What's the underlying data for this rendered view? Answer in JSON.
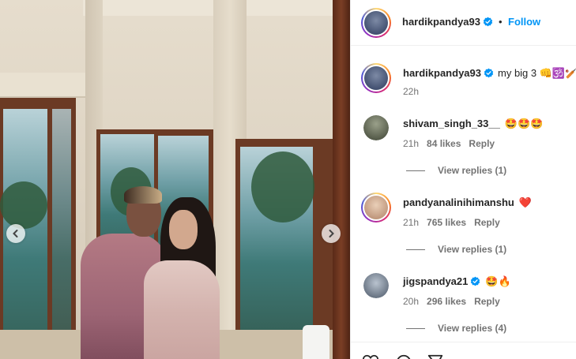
{
  "post": {
    "author": "hardikpandya93",
    "follow_label": "Follow",
    "separator": "•",
    "caption_text": "my big 3 👊🕉️🏏",
    "caption_time": "22h"
  },
  "carousel": {
    "prev_icon": "chevron-left-icon",
    "next_icon": "chevron-right-icon"
  },
  "comments": [
    {
      "username": "shivam_singh_33__",
      "verified": false,
      "text": "🤩🤩🤩",
      "time": "21h",
      "likes": "84 likes",
      "reply": "Reply",
      "view_replies": "View replies (1)"
    },
    {
      "username": "pandyanalinihimanshu",
      "verified": false,
      "text": "❤️",
      "time": "21h",
      "likes": "765 likes",
      "reply": "Reply",
      "view_replies": "View replies (1)"
    },
    {
      "username": "jigspandya21",
      "verified": true,
      "text": "🤩🔥",
      "time": "20h",
      "likes": "296 likes",
      "reply": "Reply",
      "view_replies": "View replies (4)"
    }
  ],
  "colors": {
    "link_blue": "#0095f6",
    "verified_blue": "#0095f6",
    "text": "#262626",
    "muted": "#737373"
  }
}
